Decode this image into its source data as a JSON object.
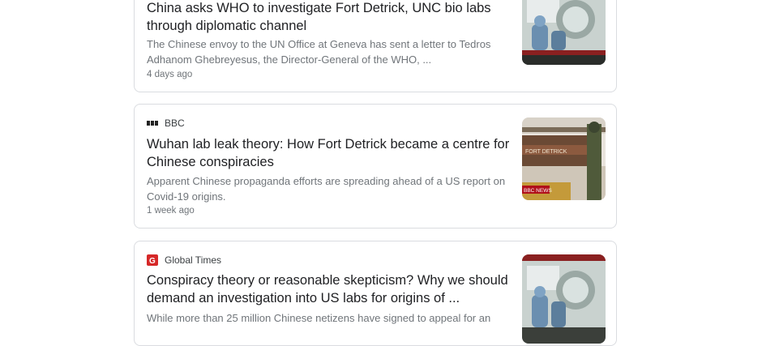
{
  "articles": [
    {
      "source": "",
      "headline": "China asks WHO to investigate Fort Detrick, UNC bio labs through diplomatic channel",
      "snippet": "The Chinese envoy to the UN Office at Geneva has sent a letter to Tedros Adhanom Ghebreyesus, the Director-General of the WHO, ...",
      "time": "4 days ago",
      "thumbnail_icon": "lab-scene-thumbnail"
    },
    {
      "source": "BBC",
      "source_icon": "bbc-logo-icon",
      "headline": "Wuhan lab leak theory: How Fort Detrick became a centre for Chinese conspiracies",
      "snippet": "Apparent Chinese propaganda efforts are spreading ahead of a US report on Covid-19 origins.",
      "time": "1 week ago",
      "thumbnail_icon": "fort-detrick-sign-thumbnail",
      "thumbnail_text": "FORT DETRICK",
      "thumbnail_badge": "BBC NEWS"
    },
    {
      "source": "Global Times",
      "source_icon": "global-times-logo-icon",
      "headline": "Conspiracy theory or reasonable skepticism? Why we should demand an investigation into US labs for origins of ...",
      "snippet": "While more than 25 million Chinese netizens have signed to appeal for an",
      "thumbnail_icon": "lab-scene-thumbnail"
    }
  ],
  "colors": {
    "card_border": "#dadce0",
    "headline": "#202124",
    "snippet": "#70757a",
    "global_times_red": "#d62828"
  }
}
